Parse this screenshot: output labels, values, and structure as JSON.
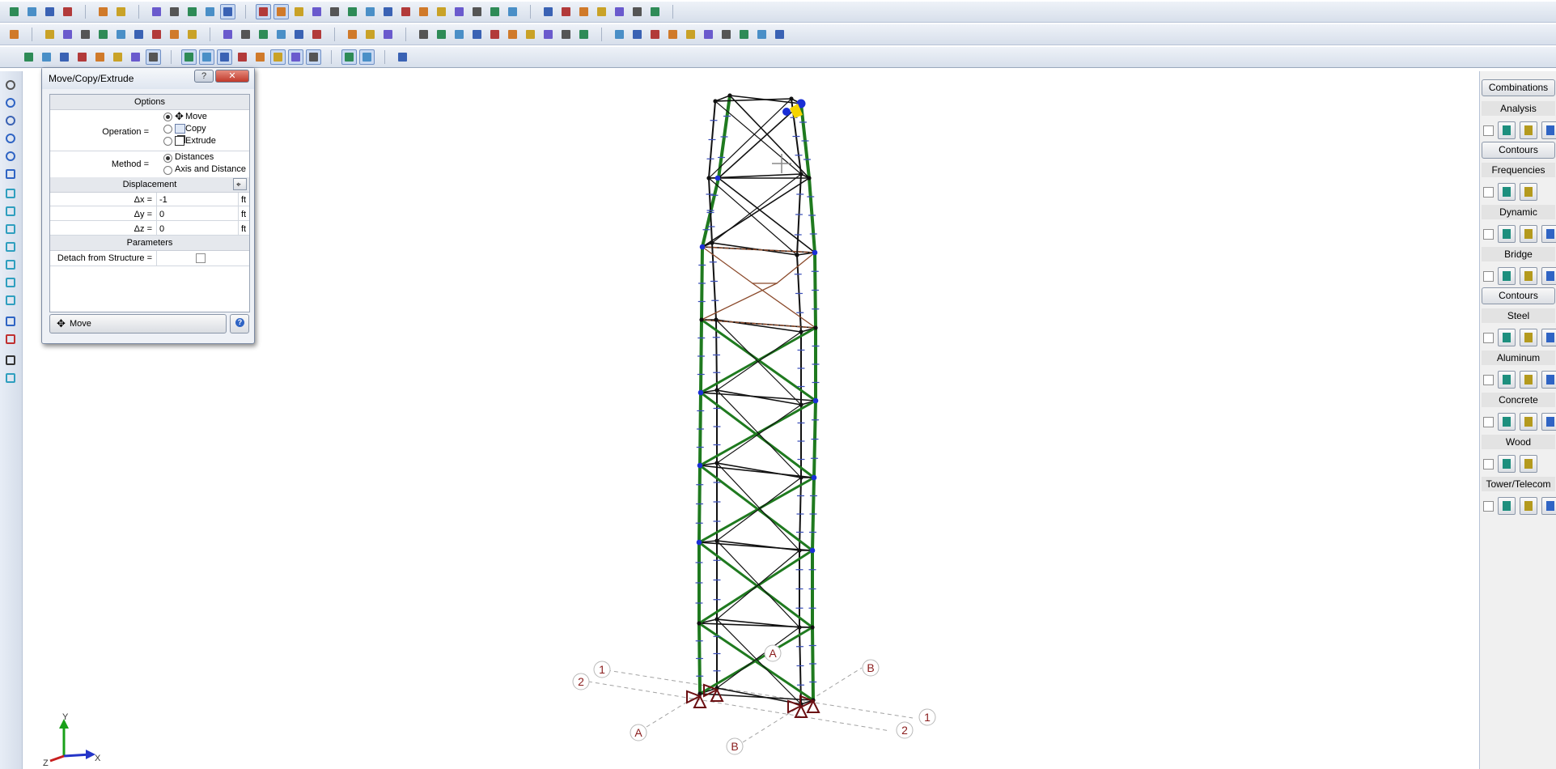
{
  "dialog": {
    "title": "Move/Copy/Extrude",
    "help_ctl": "?",
    "close_ctl": "✕",
    "options_header": "Options",
    "operation_label": "Operation =",
    "operation_options": [
      "Move",
      "Copy",
      "Extrude"
    ],
    "operation_selected": "Move",
    "method_label": "Method =",
    "method_options": [
      "Distances",
      "Axis and Distance"
    ],
    "method_selected": "Distances",
    "displacement_header": "Displacement",
    "dx_label": "Δx =",
    "dx_value": "-1",
    "dy_label": "Δy =",
    "dy_value": "0",
    "dz_label": "Δz =",
    "dz_value": "0",
    "unit": "ft",
    "parameters_header": "Parameters",
    "detach_label": "Detach from Structure =",
    "detach_checked": false,
    "action_button": "Move",
    "help_button": "?"
  },
  "right_panel": {
    "combinations": "Combinations",
    "analysis": "Analysis",
    "contours1": "Contours",
    "frequencies": "Frequencies",
    "dynamic": "Dynamic",
    "bridge": "Bridge",
    "contours2": "Contours",
    "steel": "Steel",
    "aluminum": "Aluminum",
    "concrete": "Concrete",
    "wood": "Wood",
    "tower_telecom": "Tower/Telecom"
  },
  "grid_labels": {
    "a_top": "A",
    "a_bottom": "A",
    "b_top": "B",
    "b_bottom": "B",
    "one_left": "1",
    "one_right": "1",
    "two_left": "2",
    "two_right": "2"
  },
  "axis_triad": {
    "x": "X",
    "y": "Y",
    "z": "Z"
  },
  "colors": {
    "member_green": "#1f7a1f",
    "member_black": "#111111",
    "node_blue": "#1a2fd6",
    "support_red": "#6b0f12",
    "grid_label": "#8a1c1c",
    "selected_yellow": "#f5d400"
  }
}
